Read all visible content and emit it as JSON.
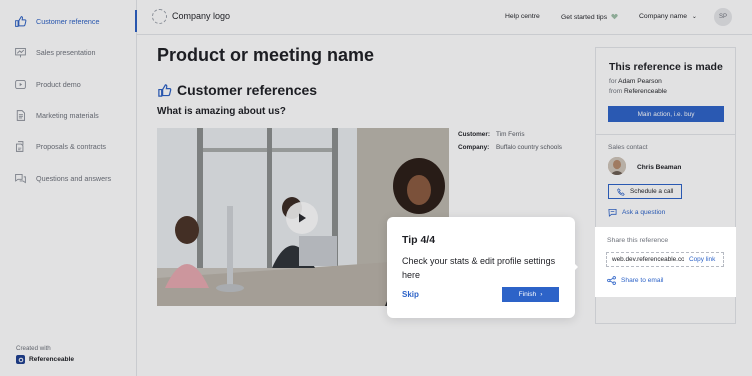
{
  "sidebar": {
    "items": [
      {
        "label": "Customer reference",
        "icon": "thumbs-up-icon",
        "active": true
      },
      {
        "label": "Sales presentation",
        "icon": "presentation-icon"
      },
      {
        "label": "Product demo",
        "icon": "video-icon"
      },
      {
        "label": "Marketing materials",
        "icon": "document-icon"
      },
      {
        "label": "Proposals & contracts",
        "icon": "contract-icon"
      },
      {
        "label": "Questions and answers",
        "icon": "chat-icon"
      }
    ],
    "created_with": "Created with",
    "brand": "Referenceable"
  },
  "topbar": {
    "logo": "Company logo",
    "help": "Help centre",
    "tips": "Get started tips",
    "company": "Company name",
    "avatar": "SP"
  },
  "main": {
    "title": "Product or meeting name",
    "section_title": "Customer references",
    "subtitle": "What is amazing about us?",
    "customer_label": "Customer:",
    "customer_value": "Tim Ferris",
    "company_label": "Company:",
    "company_value": "Buffalo country schools"
  },
  "panel": {
    "title": "This reference is made",
    "for_label": "for",
    "for_value": "Adam Pearson",
    "from_label": "from",
    "from_value": "Referenceable",
    "main_action": "Main action, i.e. buy",
    "contact_heading": "Sales contact",
    "contact_name": "Chris Beaman",
    "schedule": "Schedule a call",
    "ask": "Ask a question",
    "share_heading": "Share this reference",
    "share_url": "web.dev.referenceable.com",
    "copy_link": "Copy link",
    "share_email": "Share to email"
  },
  "tip": {
    "title": "Tip 4/4",
    "body": "Check your stats & edit profile settings here",
    "skip": "Skip",
    "finish": "Finish"
  },
  "colors": {
    "accent": "#2d63c8",
    "text": "#1e1f24",
    "muted": "#6d717a"
  }
}
